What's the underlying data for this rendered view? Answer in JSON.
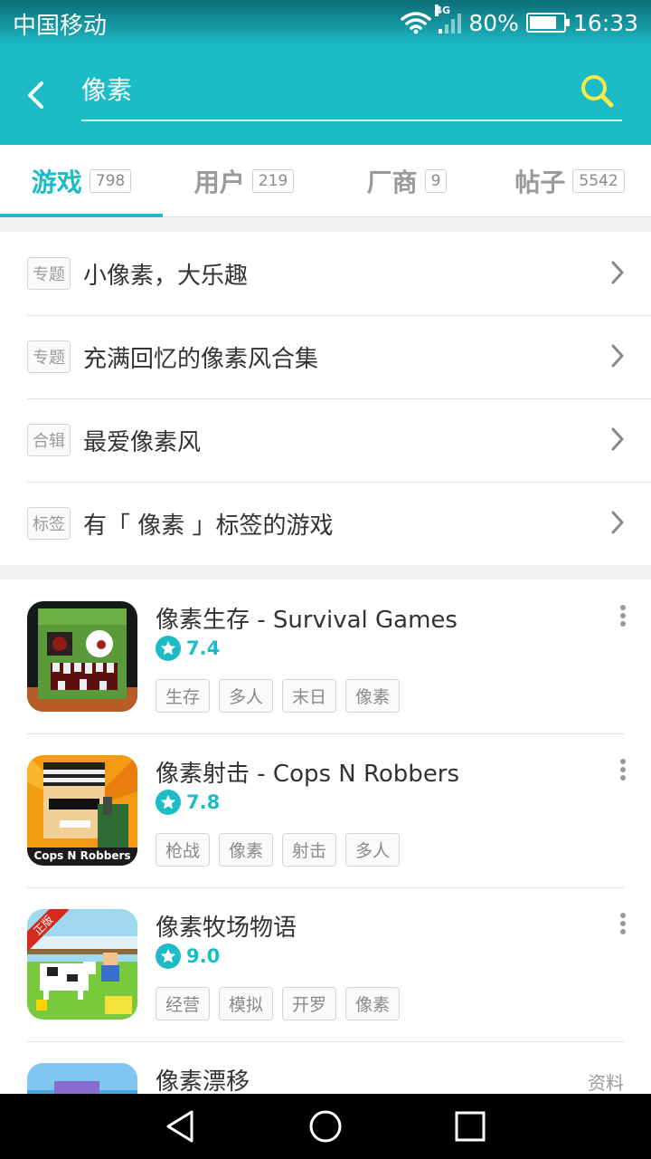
{
  "status_bar": {
    "carrier": "中国移动",
    "network": "4G",
    "battery": "80%",
    "battery_level": 0.8,
    "time": "16:33"
  },
  "search": {
    "query": "像素",
    "placeholder": ""
  },
  "tabs": [
    {
      "label": "游戏",
      "count": "798",
      "active": true
    },
    {
      "label": "用户",
      "count": "219",
      "active": false
    },
    {
      "label": "厂商",
      "count": "9",
      "active": false
    },
    {
      "label": "帖子",
      "count": "5542",
      "active": false
    }
  ],
  "topics": [
    {
      "badge": "专题",
      "title": "小像素，大乐趣"
    },
    {
      "badge": "专题",
      "title": "充满回忆的像素风合集"
    },
    {
      "badge": "合辑",
      "title": "最爱像素风"
    },
    {
      "badge": "标签",
      "title": "有「 像素 」标签的游戏"
    }
  ],
  "games": [
    {
      "title": "像素生存 - Survival Games",
      "rating": "7.4",
      "tags": [
        "生存",
        "多人",
        "末日",
        "像素"
      ]
    },
    {
      "title": "像素射击 - Cops N Robbers",
      "rating": "7.8",
      "tags": [
        "枪战",
        "像素",
        "射击",
        "多人"
      ],
      "icon_text": "Cops N Robbers"
    },
    {
      "title": "像素牧场物语",
      "rating": "9.0",
      "tags": [
        "经营",
        "模拟",
        "开罗",
        "像素"
      ],
      "icon_badge": "正版"
    },
    {
      "title": "像素漂移",
      "extra": "资料"
    }
  ],
  "icons": {
    "back": "back-arrow-icon",
    "search": "search-icon",
    "chevron": "chevron-right-icon",
    "star": "star-icon",
    "more": "more-vertical-icon",
    "nav_back": "nav-back-icon",
    "nav_home": "nav-home-icon",
    "nav_recents": "nav-recents-icon"
  },
  "colors": {
    "accent": "#1cbcc6",
    "search_icon": "#f6e94a",
    "text": "#333333",
    "muted": "#9a9a9a"
  }
}
